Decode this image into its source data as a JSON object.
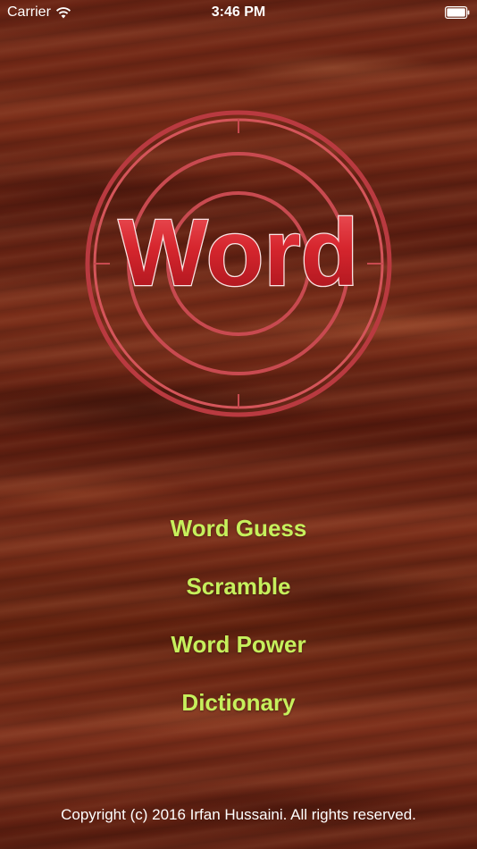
{
  "status_bar": {
    "carrier": "Carrier",
    "time": "3:46 PM",
    "wifi_icon": "wifi-icon",
    "battery_icon": "battery-icon"
  },
  "logo": {
    "text": "Word",
    "ring_color": "#c8434a",
    "text_color": "#d4252e"
  },
  "menu": {
    "items": [
      {
        "label": "Word Guess"
      },
      {
        "label": "Scramble"
      },
      {
        "label": "Word Power"
      },
      {
        "label": "Dictionary"
      }
    ],
    "text_color": "#c6f05c"
  },
  "footer": {
    "copyright": "Copyright (c) 2016 Irfan Hussaini. All rights reserved."
  }
}
